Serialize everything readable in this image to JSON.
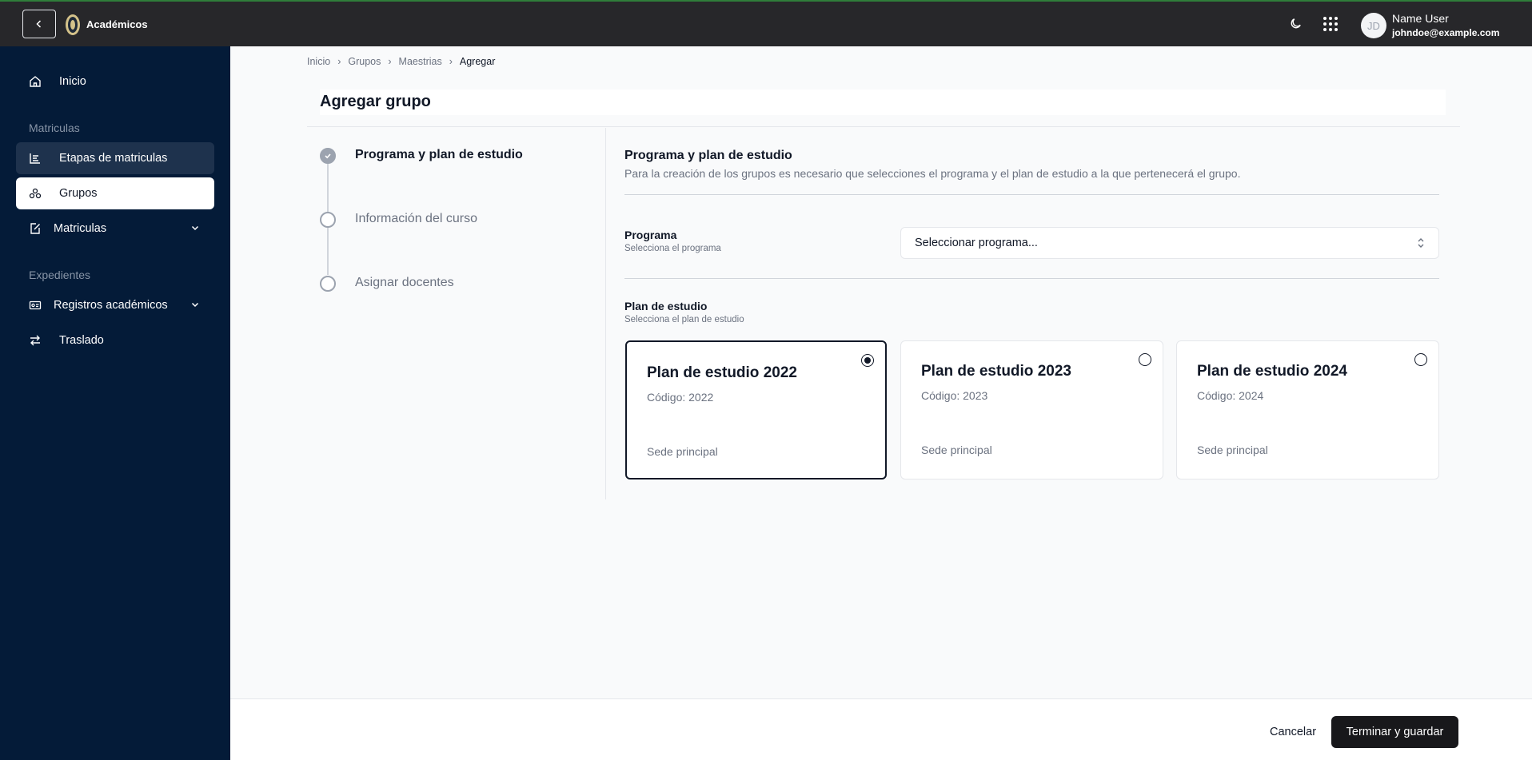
{
  "topbar": {
    "app_title": "Académicos",
    "user": {
      "initials": "JD",
      "name": "Name User",
      "email": "johndoe@example.com"
    }
  },
  "sidebar": {
    "home": "Inicio",
    "section_matriculas": "Matriculas",
    "items_matriculas": [
      {
        "label": "Etapas de matriculas"
      },
      {
        "label": "Grupos"
      },
      {
        "label": "Matriculas"
      }
    ],
    "section_expedientes": "Expedientes",
    "items_expedientes": [
      {
        "label": "Registros académicos"
      },
      {
        "label": "Traslado"
      }
    ]
  },
  "breadcrumb": [
    "Inicio",
    "Grupos",
    "Maestrias",
    "Agregar"
  ],
  "page": {
    "title": "Agregar grupo",
    "steps": [
      {
        "label": "Programa y plan de estudio",
        "status": "done"
      },
      {
        "label": "Información del curso",
        "status": "pending"
      },
      {
        "label": "Asignar docentes",
        "status": "pending"
      }
    ],
    "section": {
      "title": "Programa y plan de estudio",
      "description": "Para la creación de los grupos es necesario que selecciones el programa y el plan de estudio a la que pertenecerá el grupo."
    },
    "programa": {
      "label": "Programa",
      "help": "Selecciona el programa",
      "placeholder": "Seleccionar programa..."
    },
    "plan": {
      "label": "Plan de estudio",
      "help": "Selecciona el plan de estudio",
      "options": [
        {
          "name": "Plan de estudio 2022",
          "code": "Código: 2022",
          "sede": "Sede principal",
          "selected": true
        },
        {
          "name": "Plan de estudio 2023",
          "code": "Código: 2023",
          "sede": "Sede principal",
          "selected": false
        },
        {
          "name": "Plan de estudio 2024",
          "code": "Código: 2024",
          "sede": "Sede principal",
          "selected": false
        }
      ]
    }
  },
  "footer": {
    "cancel": "Cancelar",
    "save": "Terminar y guardar"
  },
  "colors": {
    "sidebar": "#041b38",
    "topbar": "#27272a",
    "primary_button": "#18181b",
    "accent_line": "#2f7d3a"
  }
}
